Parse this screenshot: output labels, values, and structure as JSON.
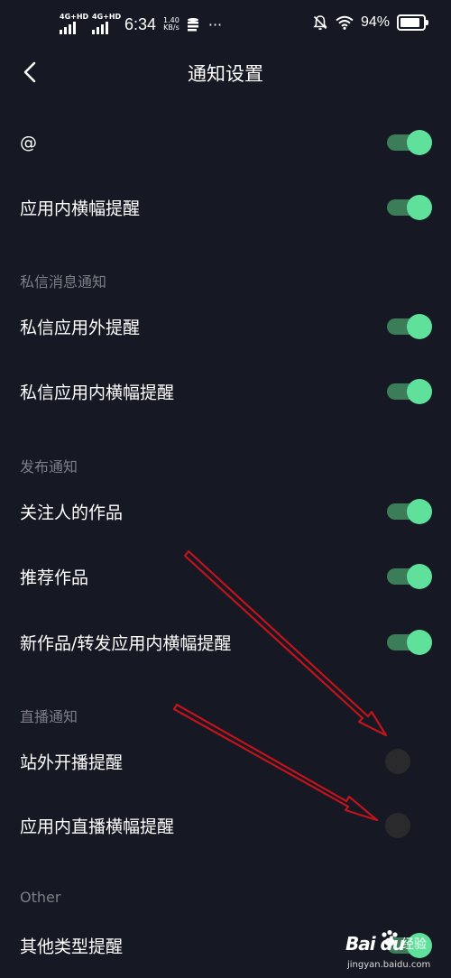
{
  "status_bar": {
    "network1": "4G+HD",
    "network2": "4G+HD",
    "time": "6:34",
    "speed_value": "1.40",
    "speed_unit": "KB/s",
    "more": "···",
    "battery": "94%"
  },
  "header": {
    "back_icon": "chevron-left-icon",
    "title": "通知设置"
  },
  "settings": {
    "at": {
      "label": "@",
      "enabled": true
    },
    "in_app_banner": {
      "label": "应用内横幅提醒",
      "enabled": true
    },
    "dm_section": "私信消息通知",
    "dm_outside": {
      "label": "私信应用外提醒",
      "enabled": true
    },
    "dm_in_app": {
      "label": "私信应用内横幅提醒",
      "enabled": true
    },
    "publish_section": "发布通知",
    "followed_works": {
      "label": "关注人的作品",
      "enabled": true
    },
    "recommended_works": {
      "label": "推荐作品",
      "enabled": true
    },
    "new_works_banner": {
      "label": "新作品/转发应用内横幅提醒",
      "enabled": true
    },
    "live_section": "直播通知",
    "live_outside": {
      "label": "站外开播提醒",
      "enabled": false
    },
    "live_in_app": {
      "label": "应用内直播横幅提醒",
      "enabled": false
    },
    "other_section": "Other",
    "other_types": {
      "label": "其他类型提醒",
      "enabled": true
    }
  },
  "watermark": {
    "logo": "Bai du",
    "brand": "经验",
    "url": "jingyan.baidu.com"
  },
  "colors": {
    "background": "#161823",
    "toggle_on_knob": "#5fe19b",
    "toggle_on_track": "#3a7d58",
    "toggle_off_knob": "#2a2a2c",
    "section_text": "#7d7e86",
    "annotation_arrow": "#c0141c"
  }
}
